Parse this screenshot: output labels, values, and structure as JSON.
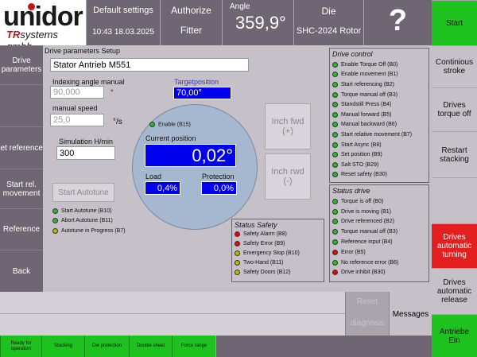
{
  "header": {
    "logo_text": "unidor",
    "logo_sub_tr": "TR",
    "logo_sub": "systems gmbh",
    "settings_label": "Default settings",
    "datetime": "10:43 18.03.2025",
    "authorize_label": "Authorize",
    "user": "Fitter",
    "angle_label": "Angle",
    "angle_value": "359,9°",
    "die_label": "Die",
    "die_value": "SHC-2024 Rotor",
    "help": "?"
  },
  "left_nav": [
    {
      "label": "Drive parameters"
    },
    {
      "label": ""
    },
    {
      "label": "set reference"
    },
    {
      "label": "Start rel. movement"
    },
    {
      "label": "Reference"
    },
    {
      "label": "Back"
    }
  ],
  "right_nav": [
    {
      "label": "Start",
      "state": "green"
    },
    {
      "label": "Continious stroke",
      "state": "grey"
    },
    {
      "label": "Drives torque off",
      "state": "grey"
    },
    {
      "label": "Restart stacking",
      "state": "grey"
    },
    {
      "label": "",
      "state": "grey"
    },
    {
      "label": "Drives automatic turning",
      "state": "red"
    },
    {
      "label": "Drives automatic release",
      "state": "grey"
    },
    {
      "label": "Antriebe Ein",
      "state": "green"
    }
  ],
  "main": {
    "title": "Drive parameters Setup",
    "name": "Stator Antrieb M551",
    "indexing_label": "Indexing angle manual",
    "indexing_value": "90,000",
    "indexing_unit": "°",
    "speed_label": "manual speed",
    "speed_value": "25,0",
    "speed_unit": "°/s",
    "sim_label": "Simulation H/min",
    "sim_value": "300",
    "target_label": "Targetposition",
    "target_value": "70,00°",
    "start_autotune": "Start Autotune",
    "enable_label": "Enable (B15)",
    "current_label": "Current position",
    "current_value": "0,02°",
    "load_label": "Load",
    "load_value": "0,4%",
    "protection_label": "Protection",
    "protection_value": "0,0%",
    "inch_fwd": "Inch fwd",
    "inch_fwd_sym": "(+)",
    "inch_rwd": "Inch rwd",
    "inch_rwd_sym": "(-)"
  },
  "autotune_items": [
    {
      "label": "Start Autotune (B10)",
      "led": "green"
    },
    {
      "label": "Abort Autotune (B11)",
      "led": "green"
    },
    {
      "label": "Autotune in Progress (B7)",
      "led": "yellow"
    }
  ],
  "drive_control": {
    "title": "Drive control",
    "items": [
      {
        "label": "Enable Torque Off (B0)",
        "led": "green"
      },
      {
        "label": "Enable movement (B1)",
        "led": "green"
      },
      {
        "label": "Start referencing (B2)",
        "led": "green"
      },
      {
        "label": "Torque manual off (B3)",
        "led": "green"
      },
      {
        "label": "Standstill Press (B4)",
        "led": "green"
      },
      {
        "label": "Manual forward (B5)",
        "led": "green"
      },
      {
        "label": "Manual backward (B6)",
        "led": "green"
      },
      {
        "label": "Start relative movement (B7)",
        "led": "green"
      },
      {
        "label": "Start Async (B8)",
        "led": "green"
      },
      {
        "label": "Set position (B9)",
        "led": "green"
      },
      {
        "label": "Salt STO (B29)",
        "led": "green"
      },
      {
        "label": "Reset safety (B30)",
        "led": "green"
      }
    ]
  },
  "status_drive": {
    "title": "Status drive",
    "items": [
      {
        "label": "Torque is off (B0)",
        "led": "green"
      },
      {
        "label": "Drive is moving (B1)",
        "led": "green"
      },
      {
        "label": "Drive referenced (B2)",
        "led": "green"
      },
      {
        "label": "Torque manual off (B3)",
        "led": "green"
      },
      {
        "label": "Reference input (B4)",
        "led": "green"
      },
      {
        "label": "Error (B5)",
        "led": "red"
      },
      {
        "label": "No reference error (B6)",
        "led": "green"
      },
      {
        "label": "Drive inhibit (B30)",
        "led": "red"
      }
    ]
  },
  "status_safety": {
    "title": "Status Safety",
    "items": [
      {
        "label": "Safety Alarm (B8)",
        "led": "red"
      },
      {
        "label": "Safety Error (B9)",
        "led": "red"
      },
      {
        "label": "Emergency Stop (B10)",
        "led": "yellow"
      },
      {
        "label": "Two-Hand (B11)",
        "led": "yellow"
      },
      {
        "label": "Safety Doors (B12)",
        "led": "yellow"
      }
    ]
  },
  "bottom": {
    "reset": "Reset",
    "diagnosis": "diagnosis",
    "messages": "Messages"
  },
  "tabs": [
    {
      "label": "Ready for operation"
    },
    {
      "label": "Stacking"
    },
    {
      "label": "Die protection"
    },
    {
      "label": "Double sheet"
    },
    {
      "label": "Force range"
    }
  ]
}
